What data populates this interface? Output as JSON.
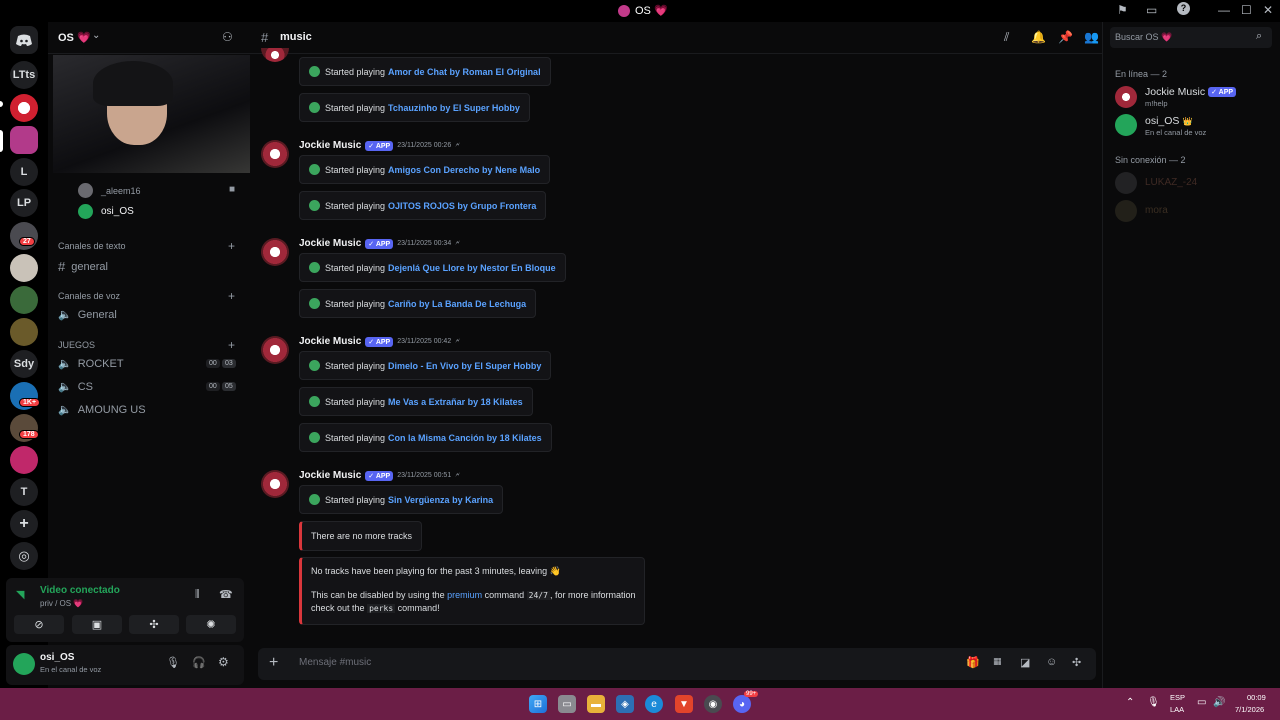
{
  "window": {
    "title": "OS 💗"
  },
  "rail": {
    "servers": [
      "LTts",
      "L",
      "LP",
      "Sdy",
      "T"
    ],
    "badges": [
      "27",
      "1K+",
      "178"
    ]
  },
  "sidebar": {
    "server_name": "OS 💗",
    "voice_users": [
      "_aleem16",
      "osi_OS"
    ],
    "categories": {
      "text": "Canales de texto",
      "voice": "Canales de voz",
      "games": "JUEGOS"
    },
    "channels": {
      "general_text": "general",
      "general_voice": "General",
      "rocket": "ROCKET",
      "cs": "CS",
      "among": "AMOUNG US"
    },
    "counters": {
      "rocket_a": "00",
      "rocket_b": "03",
      "cs_a": "00",
      "cs_b": "05"
    }
  },
  "voice_panel": {
    "status": "Video conectado",
    "location": "priv / OS 💗"
  },
  "user_panel": {
    "name": "osi_OS",
    "status": "En el canal de voz"
  },
  "channel": {
    "name": "music",
    "composer_placeholder": "Mensaje #music"
  },
  "messages": {
    "author": "Jockie Music",
    "app_badge": "APP",
    "started_label": "Started playing",
    "t1": "23/11/2025 00:26",
    "t2": "23/11/2025 00:34",
    "t3": "23/11/2025 00:42",
    "t4": "23/11/2025 00:51",
    "tracks": [
      "Amor de Chat by Roman El Original",
      "Tchauzinho by El Super Hobby",
      "Amigos Con Derecho by Nene Malo",
      "OJITOS ROJOS by Grupo Frontera",
      "Dejenlá Que Llore by Nestor En Bloque",
      "Cariño by La Banda De Lechuga",
      "Dimelo - En Vivo by El Super Hobby",
      "Me Vas a Extrañar by 18 Kilates",
      "Con la Misma Canción by 18 Kilates",
      "Sin Vergüenza by Karina"
    ],
    "no_more": "There are no more tracks",
    "leaving": "No tracks have been playing for the past 3 minutes, leaving 👋",
    "disable_pre": "This can be disabled by using the",
    "premium": "premium",
    "command_word": "command",
    "cmd_247": "24/7",
    "info_pre": ", for more information",
    "checkout": "check out the",
    "perks": "perks",
    "command_end": "command!"
  },
  "members": {
    "search_placeholder": "Buscar OS 💗",
    "online_header": "En línea — 2",
    "offline_header": "Sin conexión — 2",
    "online": [
      {
        "name": "Jockie Music",
        "badge": "APP",
        "sub": "m!help"
      },
      {
        "name": "osi_OS",
        "badge": "👑",
        "sub": "En el canal de voz"
      }
    ],
    "offline": [
      "LUKAZ_-24",
      "mora"
    ]
  },
  "taskbar": {
    "lang": "ESP",
    "layout": "LAA",
    "time": "00:09",
    "date": "7/1/2026",
    "notif": "99+"
  },
  "colors": {
    "accent": "#5865f2",
    "online": "#23a55a",
    "alert": "#da373c",
    "link": "#5aa2ff",
    "taskbar": "#6b1e46"
  }
}
